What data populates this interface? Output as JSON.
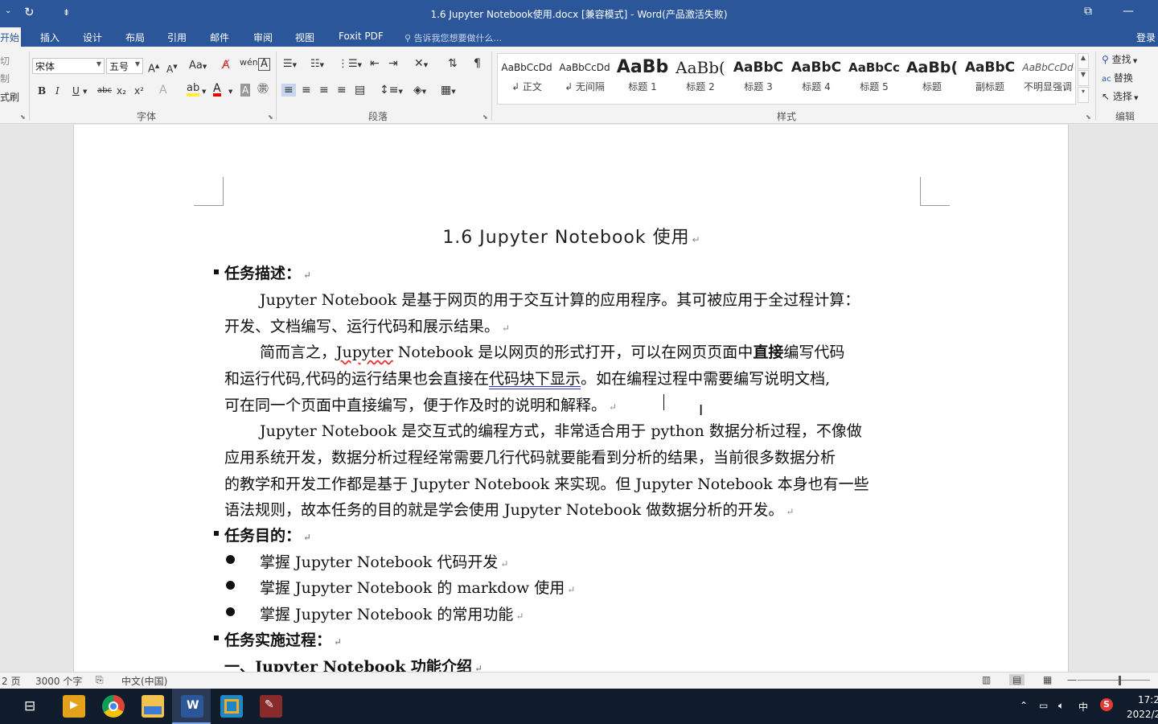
{
  "window": {
    "title": "1.6 Jupyter Notebook使用.docx [兼容模式] - Word(产品激活失败)",
    "undo_icon": "redo-icon",
    "restore_icon": "restore-window-icon",
    "minimize_icon": "minimize-icon"
  },
  "tabs": {
    "items": [
      "开始",
      "插入",
      "设计",
      "布局",
      "引用",
      "邮件",
      "审阅",
      "视图",
      "Foxit PDF"
    ],
    "tell_me": "告诉我您想要做什么...",
    "login": "登录"
  },
  "ribbon": {
    "clipboard": {
      "cut": "切",
      "copy": "制",
      "format_painter": "式刷"
    },
    "font": {
      "font_name": "宋体",
      "font_size": "五号",
      "group_label": "字体",
      "bold": "B",
      "italic": "I",
      "underline": "U",
      "strike": "abc",
      "subscript": "x₂",
      "superscript": "x²"
    },
    "paragraph": {
      "group_label": "段落"
    },
    "styles": {
      "group_label": "样式",
      "items": [
        {
          "preview": "AaBbCcDd",
          "name": "↲ 正文"
        },
        {
          "preview": "AaBbCcDd",
          "name": "↲ 无间隔"
        },
        {
          "preview": "AaBb",
          "name": "标题 1"
        },
        {
          "preview": "AaBb(",
          "name": "标题 2"
        },
        {
          "preview": "AaBbC",
          "name": "标题 3"
        },
        {
          "preview": "AaBbC",
          "name": "标题 4"
        },
        {
          "preview": "AaBbCc",
          "name": "标题 5"
        },
        {
          "preview": "AaBb(",
          "name": "标题"
        },
        {
          "preview": "AaBbC",
          "name": "副标题"
        },
        {
          "preview": "AaBbCcDd",
          "name": "不明显强调"
        }
      ]
    },
    "editing": {
      "group_label": "编辑",
      "find": "查找",
      "replace": "替换",
      "select": "选择"
    }
  },
  "document": {
    "title": "1.6 Jupyter Notebook 使用",
    "section1_heading": "任务描述：",
    "p1_line1": "Jupyter Notebook 是基于网页的用于交互计算的应用程序。其可被应用于全过程计算：",
    "p1_line2": "开发、文档编写、运行代码和展示结果。",
    "p2_line1_a": "简而言之，",
    "p2_line1_b": "Jupyter",
    "p2_line1_c": " Notebook 是以网页的形式打开，可以在网页页面中",
    "p2_line1_d": "直接",
    "p2_line1_e": "编写代码",
    "p2_line2_a": "和运行代码,代码的运行结果也会直接在",
    "p2_line2_b": "代码块下显示",
    "p2_line2_c": "。如在编程过程中需要编写说明文档,",
    "p2_line3": "可在同一个页面中直接编写，便于作及时的说明和解释。",
    "p3_line1": "Jupyter Notebook 是交互式的编程方式，非常适合用于 python 数据分析过程，不像做",
    "p3_line2": "应用系统开发，数据分析过程经常需要几行代码就要能看到分析的结果，当前很多数据分析",
    "p3_line3": "的教学和开发工作都是基于 Jupyter Notebook 来实现。但 Jupyter Notebook 本身也有一些",
    "p3_line4": "语法规则，故本任务的目的就是学会使用 Jupyter  Notebook 做数据分析的开发。",
    "section2_heading": "任务目的：",
    "bullets": [
      "掌握 Jupyter Notebook 代码开发",
      "掌握 Jupyter Notebook 的 markdow 使用",
      "掌握 Jupyter Notebook 的常用功能"
    ],
    "section3_heading": "任务实施过程：",
    "section4_heading": "一、Jupyter  Notebook 功能介绍",
    "paragraph_mark": "↵"
  },
  "status": {
    "page": "2 页",
    "words": "3000 个字",
    "language": "中文(中国)"
  },
  "taskbar": {
    "tray_ime": "中",
    "time": "17:2",
    "date": "2022/2"
  }
}
